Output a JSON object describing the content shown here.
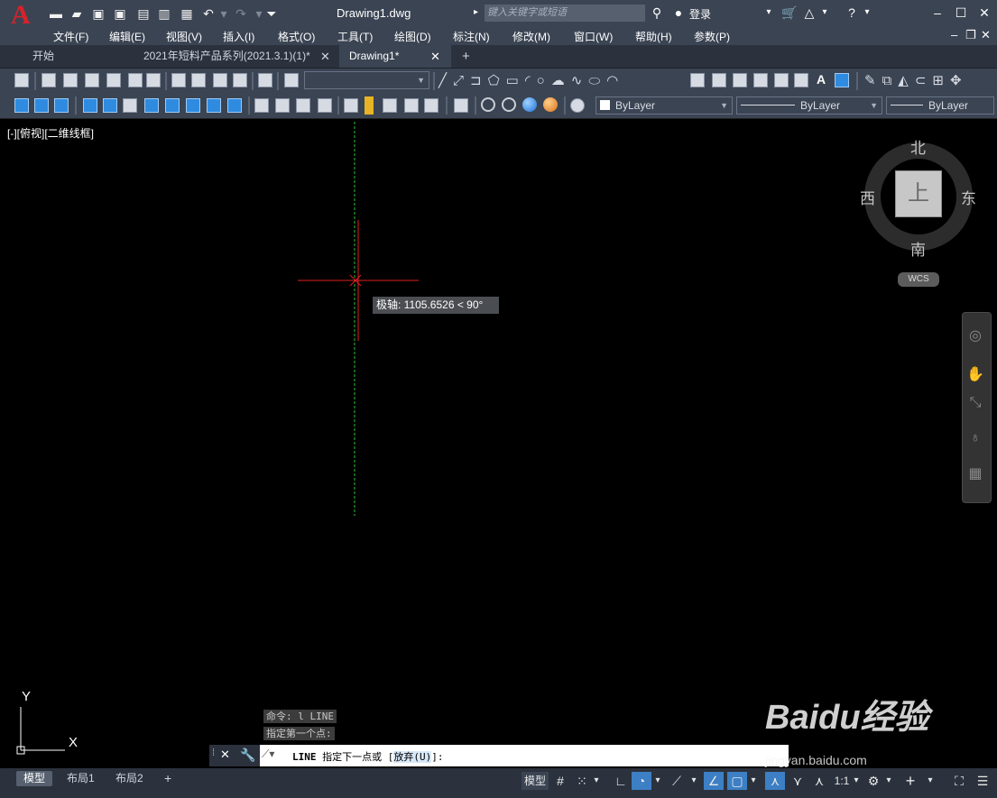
{
  "app": {
    "logo": "A",
    "file_title": "Drawing1.dwg",
    "search_placeholder": "键入关键字或短语",
    "login": "登录"
  },
  "menu": [
    "文件(F)",
    "编辑(E)",
    "视图(V)",
    "插入(I)",
    "格式(O)",
    "工具(T)",
    "绘图(D)",
    "标注(N)",
    "修改(M)",
    "窗口(W)",
    "帮助(H)",
    "参数(P)"
  ],
  "tabs": [
    {
      "label": "开始",
      "active": false
    },
    {
      "label": "2021年短料产品系列(2021.3.1)(1)*",
      "active": false
    },
    {
      "label": "Drawing1*",
      "active": true
    }
  ],
  "properties": {
    "layer": "ByLayer",
    "linetype": "ByLayer",
    "lineweight": "ByLayer"
  },
  "viewport": {
    "label": "[-][俯视][二维线框]"
  },
  "tooltip": "极轴: 1105.6526 < 90°",
  "viewcube": {
    "top": "上",
    "north": "北",
    "south": "南",
    "east": "东",
    "west": "西",
    "wcs": "WCS"
  },
  "ucs": {
    "y": "Y",
    "x": "X"
  },
  "command": {
    "history": [
      "命令: l LINE",
      "指定第一个点:"
    ],
    "prompt_cmd": "LINE",
    "prompt_text": "指定下一点或 [",
    "prompt_option": "放弃(U)",
    "prompt_end": "]:"
  },
  "layouts": [
    {
      "label": "模型",
      "active": true
    },
    {
      "label": "布局1",
      "active": false
    },
    {
      "label": "布局2",
      "active": false
    }
  ],
  "status": {
    "model": "模型",
    "scale": "1:1"
  },
  "watermark": {
    "brand": "Baidu经验",
    "url": "jingyan.baidu.com"
  },
  "colors": {
    "crosshair": "#e02020",
    "tracking": "#2fbf3c",
    "accent": "#3c7fc4"
  }
}
